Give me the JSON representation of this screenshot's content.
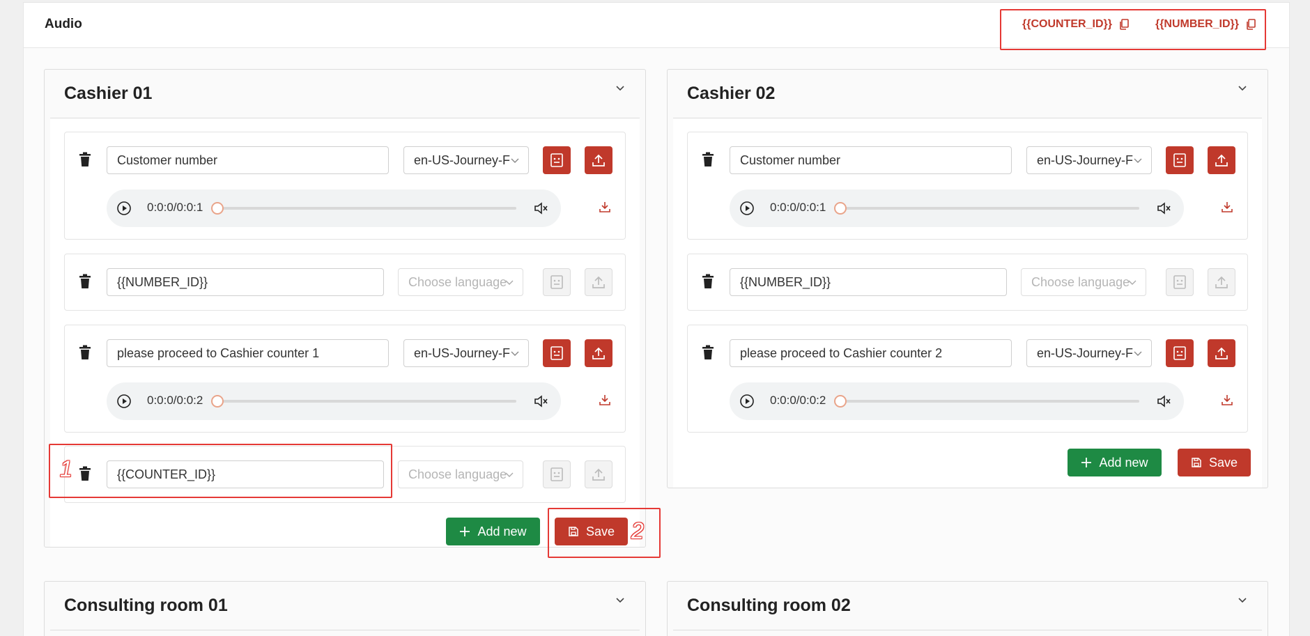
{
  "header": {
    "title": "Audio"
  },
  "variables": [
    {
      "label": "{{COUNTER_ID}}"
    },
    {
      "label": "{{NUMBER_ID}}"
    }
  ],
  "colors": {
    "accent": "#c0392b",
    "add": "#1e8a44",
    "annotation": "#e53935"
  },
  "cards": {
    "cashier01": {
      "title": "Cashier 01",
      "rows": [
        {
          "text": "Customer number",
          "language": "en-US-Journey-F",
          "time": "0:0:0/0:0:1"
        },
        {
          "text": "{{NUMBER_ID}}",
          "language_placeholder": "Choose language"
        },
        {
          "text": "please proceed to Cashier counter 1",
          "language": "en-US-Journey-F",
          "time": "0:0:0/0:0:2"
        },
        {
          "text": "{{COUNTER_ID}}",
          "language_placeholder": "Choose language"
        }
      ],
      "add_label": "Add new",
      "save_label": "Save"
    },
    "cashier02": {
      "title": "Cashier 02",
      "rows": [
        {
          "text": "Customer number",
          "language": "en-US-Journey-F",
          "time": "0:0:0/0:0:1"
        },
        {
          "text": "{{NUMBER_ID}}",
          "language_placeholder": "Choose language"
        },
        {
          "text": "please proceed to Cashier counter 2",
          "language": "en-US-Journey-F",
          "time": "0:0:0/0:0:2"
        }
      ],
      "add_label": "Add new",
      "save_label": "Save"
    },
    "consult01": {
      "title": "Consulting room 01"
    },
    "consult02": {
      "title": "Consulting room 02"
    }
  },
  "annotations": [
    "1",
    "2"
  ]
}
